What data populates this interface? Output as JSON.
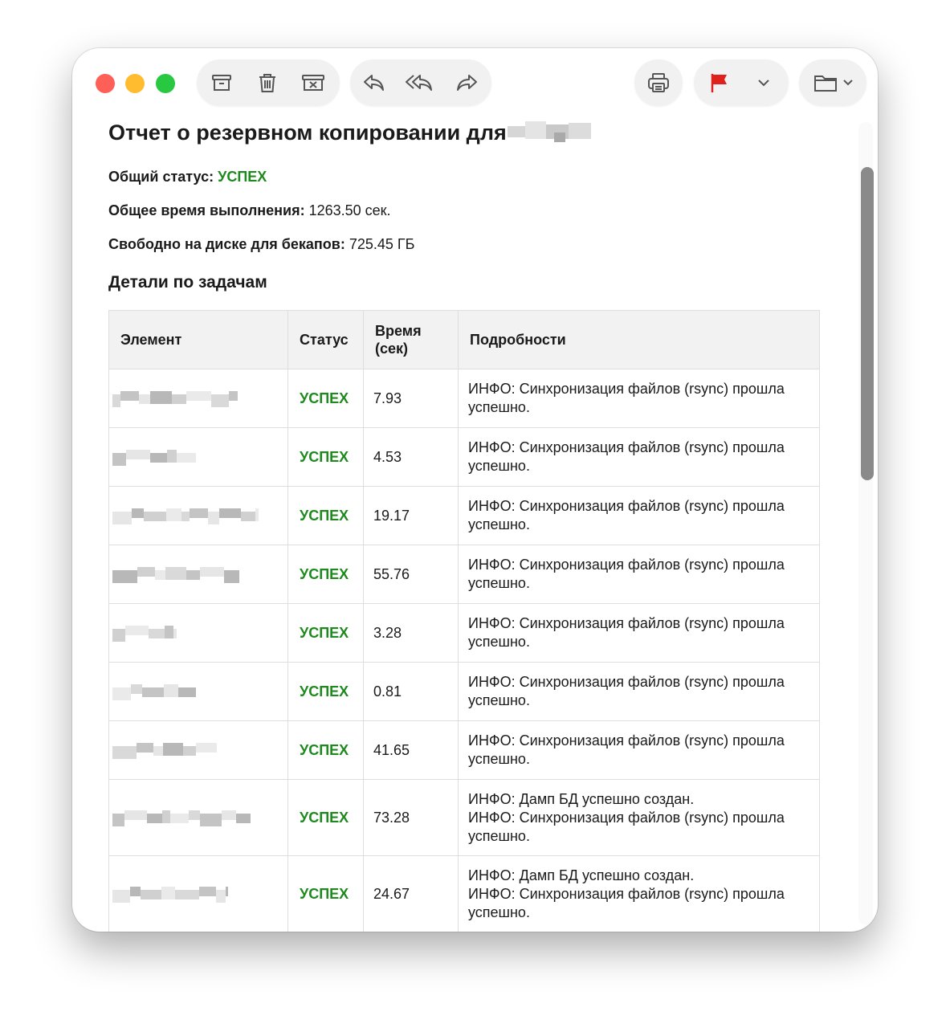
{
  "toolbar": {
    "buttons": [
      {
        "name": "archive-icon"
      },
      {
        "name": "trash-icon"
      },
      {
        "name": "junk-icon"
      },
      {
        "name": "reply-icon"
      },
      {
        "name": "reply-all-icon"
      },
      {
        "name": "forward-icon"
      },
      {
        "name": "print-icon"
      },
      {
        "name": "flag-icon"
      },
      {
        "name": "chevron-down-icon"
      },
      {
        "name": "folder-icon"
      }
    ],
    "flag_color": "#e0201c"
  },
  "report": {
    "title": "Отчет о резервном копировании для",
    "overall_status_label": "Общий статус:",
    "overall_status_value": "УСПЕХ",
    "total_time_label": "Общее время выполнения:",
    "total_time_value": "1263.50 сек.",
    "free_space_label": "Свободно на диске для бекапов:",
    "free_space_value": "725.45 ГБ",
    "details_heading": "Детали по задачам",
    "status_color": "#1e8a1e"
  },
  "table": {
    "headers": {
      "element": "Элемент",
      "status": "Статус",
      "time": "Время (сек)",
      "details": "Подробности"
    },
    "rows": [
      {
        "status": "УСПЕХ",
        "time": "7.93",
        "details": [
          "ИНФО: Синхронизация файлов (rsync) прошла успешно."
        ]
      },
      {
        "status": "УСПЕХ",
        "time": "4.53",
        "details": [
          "ИНФО: Синхронизация файлов (rsync) прошла успешно."
        ]
      },
      {
        "status": "УСПЕХ",
        "time": "19.17",
        "details": [
          "ИНФО: Синхронизация файлов (rsync) прошла успешно."
        ]
      },
      {
        "status": "УСПЕХ",
        "time": "55.76",
        "details": [
          "ИНФО: Синхронизация файлов (rsync) прошла успешно."
        ]
      },
      {
        "status": "УСПЕХ",
        "time": "3.28",
        "details": [
          "ИНФО: Синхронизация файлов (rsync) прошла успешно."
        ]
      },
      {
        "status": "УСПЕХ",
        "time": "0.81",
        "details": [
          "ИНФО: Синхронизация файлов (rsync) прошла успешно."
        ]
      },
      {
        "status": "УСПЕХ",
        "time": "41.65",
        "details": [
          "ИНФО: Синхронизация файлов (rsync) прошла успешно."
        ]
      },
      {
        "status": "УСПЕХ",
        "time": "73.28",
        "details": [
          "ИНФО: Дамп БД успешно создан.",
          "ИНФО: Синхронизация файлов (rsync) прошла успешно."
        ]
      },
      {
        "status": "УСПЕХ",
        "time": "24.67",
        "details": [
          "ИНФО: Дамп БД успешно создан.",
          "ИНФО: Синхронизация файлов (rsync) прошла успешно."
        ]
      }
    ]
  }
}
